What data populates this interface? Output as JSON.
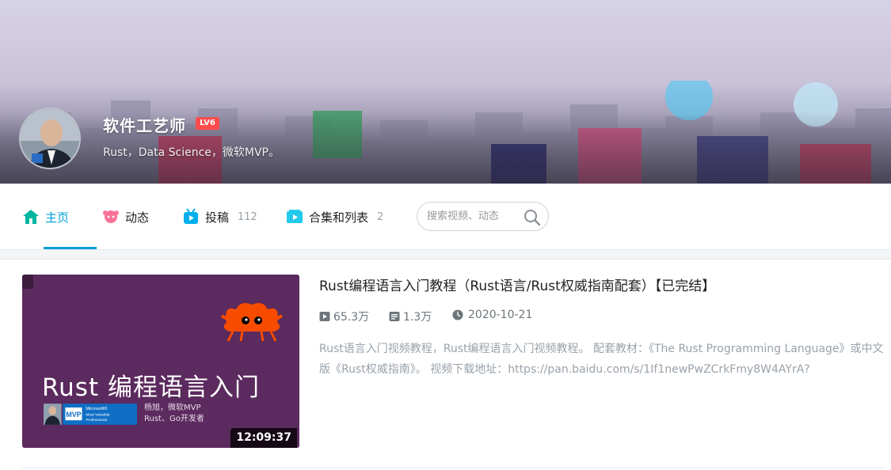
{
  "banner": {
    "user_name": "软件工艺师",
    "level": "LV6",
    "sign": "Rust，Data Science，微软MVP。"
  },
  "nav": {
    "items": [
      {
        "label": "主页",
        "count": ""
      },
      {
        "label": "动态",
        "count": ""
      },
      {
        "label": "投稿",
        "count": "112"
      },
      {
        "label": "合集和列表",
        "count": "2"
      }
    ],
    "active_index": 0,
    "search_placeholder": "搜索视频、动态"
  },
  "video": {
    "title": "Rust编程语言入门教程（Rust语言/Rust权威指南配套）【已完结】",
    "views": "65.3万",
    "danmaku": "1.3万",
    "date": "2020-10-21",
    "description": "Rust语言入门视频教程，Rust编程语言入门视频教程。 配套教材：《The Rust Programming Language》或中文版《Rust权威指南》。 视频下载地址：https://pan.baidu.com/s/1If1newPwZCrkFmy8W4AYrA?",
    "duration": "12:09:37",
    "thumbnail": {
      "title": "Rust 编程语言入门",
      "mvp_badge_line1": "Microsoft®",
      "mvp_badge_line2": "Most Valuable",
      "mvp_badge_line3": "Professional",
      "mvp_label": "MVP",
      "author_line1": "杨旭，微软MVP",
      "author_line2": "Rust、Go开发者"
    }
  },
  "colors": {
    "accent": "#00a1d6",
    "home_icon": "#00b5a1",
    "dynamic_icon": "#fb7299",
    "upload_icon": "#00aeec",
    "collection_icon": "#23c9ed",
    "level_badge": "#ff4c4c",
    "thumbnail_bg": "#5b2a5e",
    "crab": "#f74c00"
  },
  "icons": {
    "home": "home-icon",
    "dynamic": "dynamic-icon",
    "upload": "upload-icon",
    "collection": "collection-icon",
    "search": "search-icon",
    "play": "play-count-icon",
    "danmaku": "danmaku-icon",
    "clock": "clock-icon",
    "crab": "ferris-crab-icon"
  }
}
